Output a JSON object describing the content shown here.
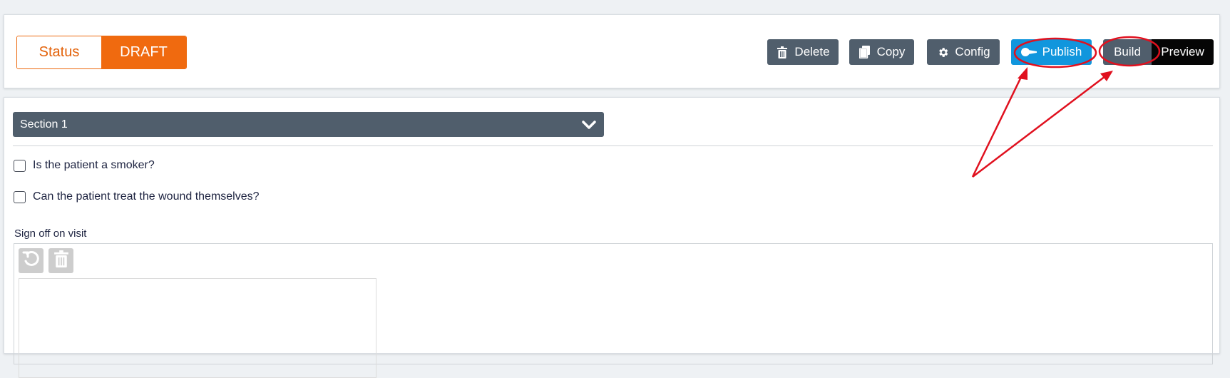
{
  "status": {
    "label": "Status",
    "value": "DRAFT"
  },
  "toolbar": {
    "delete_label": "Delete",
    "copy_label": "Copy",
    "config_label": "Config",
    "publish_label": "Publish",
    "build_label": "Build",
    "preview_label": "Preview"
  },
  "section": {
    "title": "Section 1"
  },
  "questions": [
    {
      "label": "Is the patient a smoker?",
      "checked": false
    },
    {
      "label": "Can the patient treat the wound themselves?",
      "checked": false
    }
  ],
  "signature": {
    "label": "Sign off on visit"
  },
  "colors": {
    "accent_orange": "#f06a0f",
    "button_gray": "#505e6c",
    "publish_blue": "#1196dd",
    "annotation_red": "#e0101e"
  },
  "icons": {
    "delete": "trash-icon",
    "copy": "copy-icon",
    "config": "gear-icon",
    "publish": "key-icon",
    "section_toggle": "chevron-down-icon",
    "undo": "undo-icon",
    "clear": "trash-icon"
  }
}
